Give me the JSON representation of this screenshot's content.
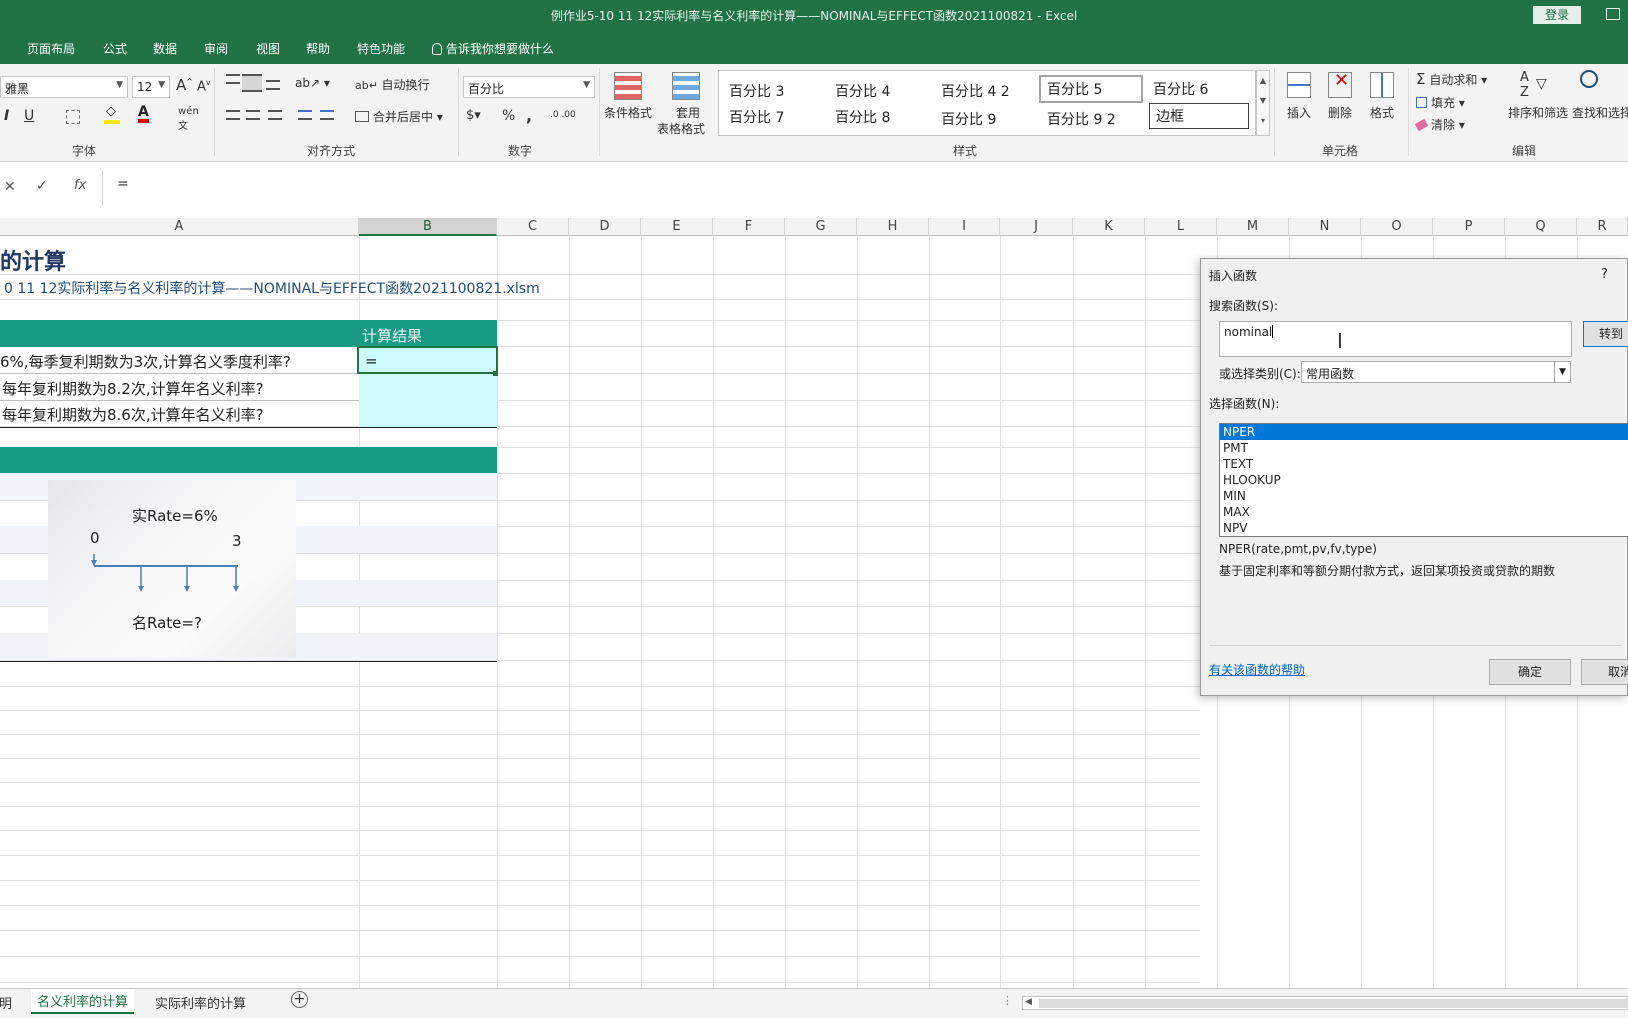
{
  "window": {
    "title": "例作业5-10 11 12实际利率与名义利率的计算——NOMINAL与EFFECT函数2021100821  -  Excel",
    "login_label": "登录"
  },
  "menu": {
    "items": [
      "页面布局",
      "公式",
      "数据",
      "审阅",
      "视图",
      "帮助",
      "特色功能"
    ],
    "tell_me": "告诉我你想要做什么"
  },
  "ribbon": {
    "font_name": "雅黑",
    "font_size": "12",
    "wrap_text": "自动换行",
    "merge_center": "合并后居中",
    "number_format": "百分比",
    "cond_format": "条件格式",
    "table_format_1": "套用",
    "table_format_2": "表格格式",
    "styles": [
      "百分比 3",
      "百分比 4",
      "百分比 4 2",
      "百分比  5",
      "百分比  6",
      "百分比  7",
      "百分比 8",
      "百分比 9",
      "百分比 9 2",
      "边框"
    ],
    "insert": "插入",
    "delete": "删除",
    "format": "格式",
    "autosum": "自动求和",
    "fill": "填充",
    "clear": "清除",
    "sort_filter": "排序和筛选",
    "find_select": "查找和选择",
    "groups": {
      "font": "字体",
      "alignment": "对齐方式",
      "number": "数字",
      "styles": "样式",
      "cells": "单元格",
      "editing": "编辑"
    }
  },
  "formula_bar": {
    "content": "="
  },
  "columns": [
    "A",
    "B",
    "C",
    "D",
    "E",
    "F",
    "G",
    "H",
    "I",
    "J",
    "K",
    "L",
    "M",
    "N",
    "O",
    "P",
    "Q",
    "R"
  ],
  "sheet": {
    "title": "的计算",
    "filename": "0 11 12实际利率与名义利率的计算——NOMINAL与EFFECT函数2021100821.xlsm",
    "result_header": "计算结果",
    "q1": "6%,每季复利期数为3次,计算名义季度利率?",
    "q2": "每年复利期数为8.2次,计算年名义利率?",
    "q3": "每年复利期数为8.6次,计算年名义利率?",
    "active_cell_value": "=",
    "diagram": {
      "real_rate": "实Rate=6%",
      "start": "0",
      "end": "3",
      "nominal_rate": "名Rate=?"
    }
  },
  "dialog": {
    "title": "插入函数",
    "help_mark": "?",
    "search_label": "搜索函数(S):",
    "search_value": "nominal",
    "go_button": "转到",
    "category_label": "或选择类别(C):",
    "category_value": "常用函数",
    "select_label": "选择函数(N):",
    "functions": [
      "NPER",
      "PMT",
      "TEXT",
      "HLOOKUP",
      "MIN",
      "MAX",
      "NPV"
    ],
    "selected_function": "NPER",
    "signature": "NPER(rate,pmt,pv,fv,type)",
    "description": "基于固定利率和等额分期付款方式，返回某项投资或贷款的期数",
    "help_link": "有关该函数的帮助",
    "ok_button": "确定",
    "cancel_button": "取消"
  },
  "tabs": {
    "items": [
      "说明",
      "名义利率的计算",
      "实际利率的计算"
    ],
    "active": "名义利率的计算"
  }
}
